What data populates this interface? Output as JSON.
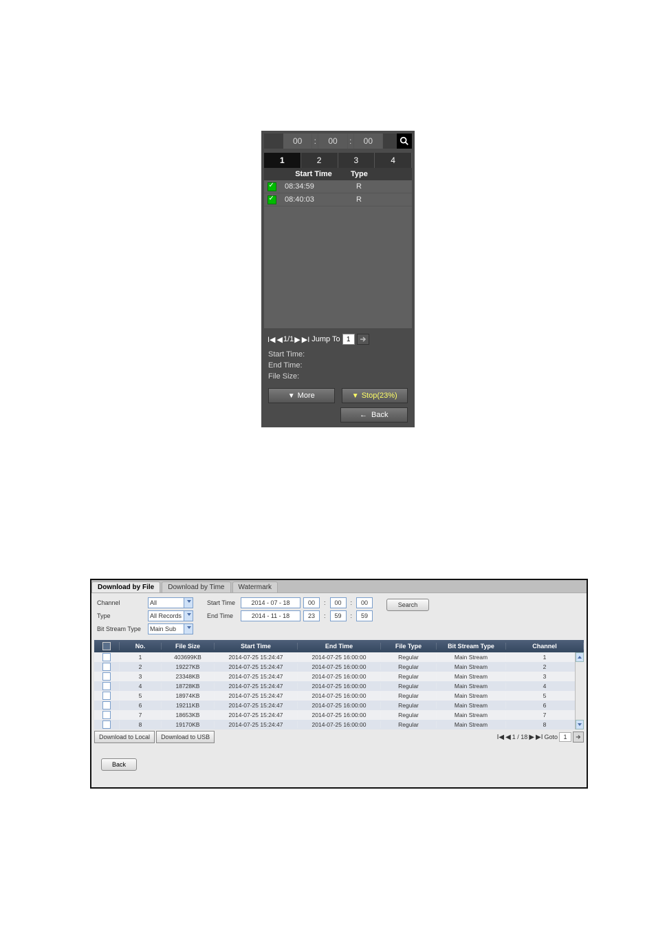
{
  "panel1": {
    "time": {
      "h": "00",
      "m": "00",
      "s": "00",
      "sep": ":"
    },
    "view_nums": [
      "1",
      "2",
      "3",
      "4"
    ],
    "headers": {
      "start": "Start Time",
      "type": "Type"
    },
    "rows": [
      {
        "checked": true,
        "start": "08:34:59",
        "type": "R"
      },
      {
        "checked": true,
        "start": "08:40:03",
        "type": "R"
      }
    ],
    "pager": {
      "pos": "1/1",
      "jump_label": "Jump To",
      "jump_value": "1"
    },
    "info": {
      "start_label": "Start Time:",
      "end_label": "End Time:",
      "size_label": "File Size:"
    },
    "buttons": {
      "more": "More",
      "stop": "Stop(23%)",
      "back": "Back"
    }
  },
  "panel2": {
    "tabs": [
      "Download by File",
      "Download by Time",
      "Watermark"
    ],
    "active_tab": 0,
    "filters": {
      "channel_label": "Channel",
      "channel_value": "All",
      "type_label": "Type",
      "type_value": "All Records",
      "bst_label": "Bit Stream Type",
      "bst_value": "Main Sub",
      "start_label": "Start Time",
      "start_date": "2014 - 07 - 18",
      "start_h": "00",
      "start_m": "00",
      "start_s": "00",
      "end_label": "End Time",
      "end_date": "2014 - 11 - 18",
      "end_h": "23",
      "end_m": "59",
      "end_s": "59",
      "search": "Search",
      "colon": ":"
    },
    "columns": [
      "",
      "No.",
      "File Size",
      "Start Time",
      "End Time",
      "File Type",
      "Bit Stream Type",
      "Channel"
    ],
    "rows": [
      {
        "no": "1",
        "fs": "403699KB",
        "st": "2014-07-25 15:24:47",
        "et": "2014-07-25 16:00:00",
        "ft": "Regular",
        "bt": "Main Stream",
        "ch": "1"
      },
      {
        "no": "2",
        "fs": "19227KB",
        "st": "2014-07-25 15:24:47",
        "et": "2014-07-25 16:00:00",
        "ft": "Regular",
        "bt": "Main Stream",
        "ch": "2"
      },
      {
        "no": "3",
        "fs": "23348KB",
        "st": "2014-07-25 15:24:47",
        "et": "2014-07-25 16:00:00",
        "ft": "Regular",
        "bt": "Main Stream",
        "ch": "3"
      },
      {
        "no": "4",
        "fs": "18728KB",
        "st": "2014-07-25 15:24:47",
        "et": "2014-07-25 16:00:00",
        "ft": "Regular",
        "bt": "Main Stream",
        "ch": "4"
      },
      {
        "no": "5",
        "fs": "18974KB",
        "st": "2014-07-25 15:24:47",
        "et": "2014-07-25 16:00:00",
        "ft": "Regular",
        "bt": "Main Stream",
        "ch": "5"
      },
      {
        "no": "6",
        "fs": "19211KB",
        "st": "2014-07-25 15:24:47",
        "et": "2014-07-25 16:00:00",
        "ft": "Regular",
        "bt": "Main Stream",
        "ch": "6"
      },
      {
        "no": "7",
        "fs": "18653KB",
        "st": "2014-07-25 15:24:47",
        "et": "2014-07-25 16:00:00",
        "ft": "Regular",
        "bt": "Main Stream",
        "ch": "7"
      },
      {
        "no": "8",
        "fs": "19170KB",
        "st": "2014-07-25 15:24:47",
        "et": "2014-07-25 16:00:00",
        "ft": "Regular",
        "bt": "Main Stream",
        "ch": "8"
      }
    ],
    "dl_local": "Download to Local",
    "dl_usb": "Download to USB",
    "pager": {
      "pos": "1 / 18",
      "goto": "Goto",
      "goto_value": "1"
    },
    "back": "Back"
  }
}
